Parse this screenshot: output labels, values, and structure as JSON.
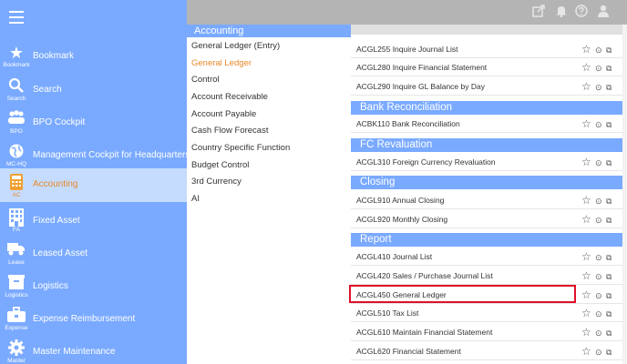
{
  "nav": {
    "items": [
      {
        "label": "Bookmark",
        "abbr": "Bookmark",
        "icon": "star-icon"
      },
      {
        "label": "Search",
        "abbr": "Search",
        "icon": "search-icon"
      },
      {
        "label": "BPO Cockpit",
        "abbr": "BPO",
        "icon": "people-icon"
      },
      {
        "label": "Management Cockpit for Headquarters",
        "abbr": "MC-HQ",
        "icon": "globe-icon"
      },
      {
        "label": "Accounting",
        "abbr": "AC",
        "icon": "calculator-icon"
      },
      {
        "label": "Fixed Asset",
        "abbr": "FA",
        "icon": "building-icon"
      },
      {
        "label": "Leased Asset",
        "abbr": "Lease",
        "icon": "truck-icon"
      },
      {
        "label": "Logistics",
        "abbr": "Logistics",
        "icon": "box-icon"
      },
      {
        "label": "Expense Reimbursement",
        "abbr": "Expense",
        "icon": "briefcase-icon"
      },
      {
        "label": "Master Maintenance",
        "abbr": "Master",
        "icon": "gear-icon"
      }
    ],
    "active_index": 4
  },
  "category": {
    "title": "Accounting",
    "items": [
      "General Ledger (Entry)",
      "General Ledger",
      "Control",
      "Account Receivable",
      "Account Payable",
      "Cash Flow Forecast",
      "Country Specific Function",
      "Budget Control",
      "3rd Currency",
      "AI"
    ],
    "active_index": 1
  },
  "programs": {
    "top_rows": [
      "ACGL255 Inquire Journal List",
      "ACGL280 Inquire Financial Statement",
      "ACGL290 Inquire GL Balance by Day"
    ],
    "sections": [
      {
        "title": "Bank Reconciliation",
        "rows": [
          "ACBK110 Bank Reconciliation"
        ]
      },
      {
        "title": "FC Revaluation",
        "rows": [
          "ACGL310 Foreign Currency Revaluation"
        ]
      },
      {
        "title": "Closing",
        "rows": [
          "ACGL910 Annual Closing",
          "ACGL920 Monthly Closing"
        ]
      },
      {
        "title": "Report",
        "rows": [
          "ACGL410 Journal List",
          "ACGL420 Sales / Purchase Journal List",
          "ACGL450 General Ledger",
          "ACGL510 Tax List",
          "ACGL610 Maintain Financial Statement",
          "ACGL620 Financial Statement"
        ]
      }
    ],
    "highlighted_row": "ACGL450 General Ledger"
  },
  "topbar": {
    "icons": [
      "export-icon",
      "bell-icon",
      "help-icon",
      "user-icon"
    ]
  },
  "colors": {
    "nav_bg": "#7aaaff",
    "active_bg": "#c5dcff",
    "accent": "#e8882a",
    "highlight_border": "#e0102a"
  }
}
